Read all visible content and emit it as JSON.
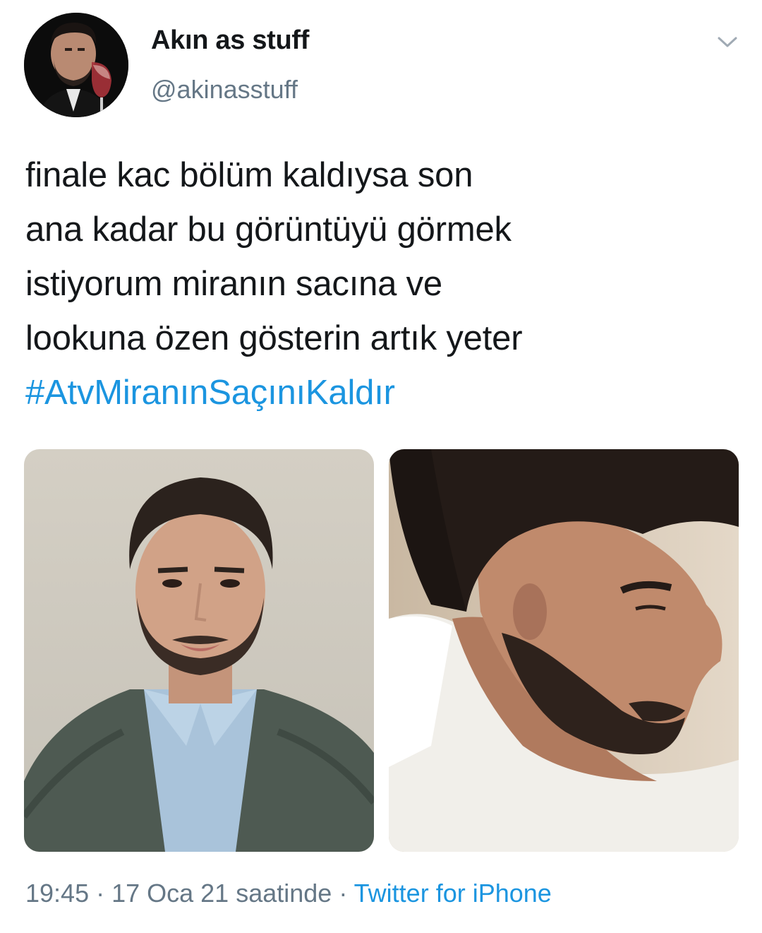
{
  "author": {
    "display_name": "Akın as stuff",
    "handle": "@akinasstuff",
    "avatar_icon": "profile-photo-avatar"
  },
  "header": {
    "menu_icon": "chevron-down-icon"
  },
  "tweet": {
    "lines": [
      "finale kac bölüm kaldıysa son",
      "ana kadar bu görüntüyü görmek",
      "istiyorum miranın sacına ve",
      "lookuna özen gösterin artık yeter"
    ],
    "hashtag": "#AtvMiranınSaçınıKaldır"
  },
  "media": [
    {
      "icon": "photo-man-in-suit"
    },
    {
      "icon": "photo-man-profile-closeup"
    }
  ],
  "footer": {
    "time": "19:45",
    "sep1": " · ",
    "date": "17 Oca 21 saatinde",
    "sep2": " · ",
    "source": "Twitter for iPhone"
  },
  "colors": {
    "link": "#1b95e0",
    "secondary_text": "#657786",
    "primary_text": "#14171a"
  }
}
